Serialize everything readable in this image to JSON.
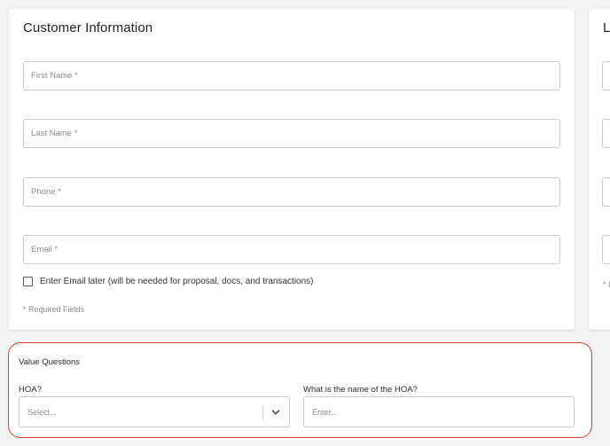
{
  "customer_info": {
    "title": "Customer Information",
    "fields": {
      "first_name": {
        "placeholder": "First Name *",
        "value": ""
      },
      "last_name": {
        "placeholder": "Last Name *",
        "value": ""
      },
      "phone": {
        "placeholder": "Phone *",
        "value": ""
      },
      "email": {
        "placeholder": "Email *",
        "value": ""
      }
    },
    "email_later": {
      "label": "Enter Email later (will be needed for proposal, docs, and transactions)",
      "checked": false
    },
    "required_note": "* Required Fields"
  },
  "location_card": {
    "title_fragment": "L",
    "note_fragment": "* I"
  },
  "value_questions": {
    "title": "Value Questions",
    "hoa": {
      "label": "HOA?",
      "selected": "Select..."
    },
    "hoa_name": {
      "label": "What is the name of the HOA?",
      "placeholder": "Enter..."
    }
  },
  "colors": {
    "highlight": "#e23b2f",
    "background": "#f3f3f4",
    "card": "#ffffff",
    "field_border": "#c9c9c9"
  },
  "icons": {
    "select_chevron": "chevron-down-icon",
    "checkbox": "checkbox-icon"
  }
}
